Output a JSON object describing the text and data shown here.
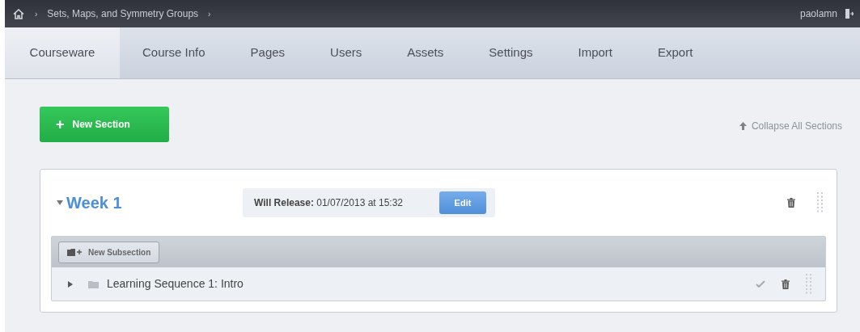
{
  "breadcrumb": {
    "separator_1": "›",
    "course": "Sets, Maps, and Symmetry Groups",
    "separator_2": "›",
    "user": "paolamn"
  },
  "tabs": [
    {
      "label": "Courseware",
      "selected": true
    },
    {
      "label": "Course Info",
      "selected": false
    },
    {
      "label": "Pages",
      "selected": false
    },
    {
      "label": "Users",
      "selected": false
    },
    {
      "label": "Assets",
      "selected": false
    },
    {
      "label": "Settings",
      "selected": false
    },
    {
      "label": "Import",
      "selected": false
    },
    {
      "label": "Export",
      "selected": false
    }
  ],
  "new_section_button": {
    "icon": "+",
    "label": "New Section"
  },
  "collapse_link": "Collapse All Sections",
  "sections": [
    {
      "title": "Week 1",
      "expanded": true,
      "release": "**Will Release:** 01/07/2013 at 15:32",
      "edit_button": "Edit",
      "new_subsection_button": "New Subsection",
      "subsections": [
        {
          "title": "Learning Sequence 1: Intro",
          "expanded": false
        }
      ]
    }
  ]
}
